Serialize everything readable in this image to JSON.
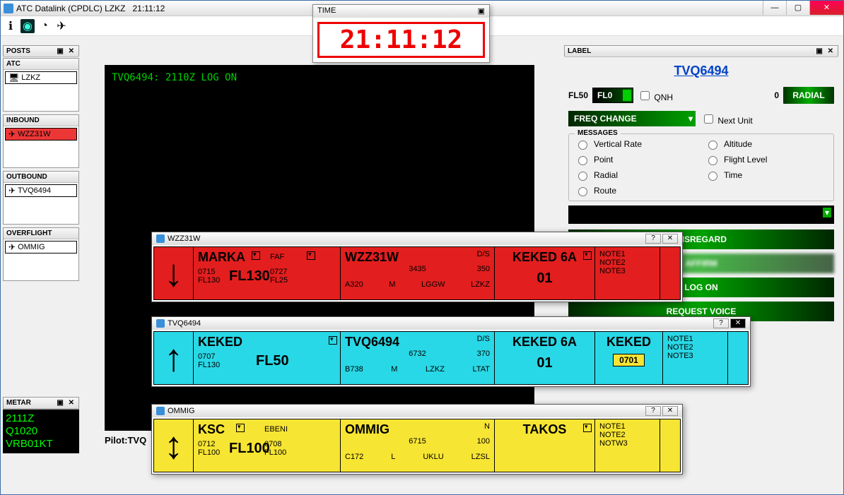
{
  "window": {
    "title": "ATC Datalink (CPDLC) LZKZ",
    "clock": "21:11:12"
  },
  "time_popup": {
    "title": "TIME",
    "value": "21:11:12"
  },
  "panels": {
    "posts_hdr": "POSTS",
    "atc": {
      "title": "ATC",
      "item": "LZKZ"
    },
    "inbound": {
      "title": "INBOUND",
      "item": "WZZ31W"
    },
    "outbound": {
      "title": "OUTBOUND",
      "item": "TVQ6494"
    },
    "overflight": {
      "title": "OVERFLIGHT",
      "item": "OMMIG"
    }
  },
  "radar": {
    "log": "TVQ6494: 2110Z LOG ON",
    "pilot": "Pilot:TVQ"
  },
  "metar": {
    "title": "METAR",
    "l1": "2111Z",
    "l2": "Q1020",
    "l3": "VRB01KT"
  },
  "label": {
    "title": "LABEL",
    "callsign": "TVQ6494",
    "fl_current": "FL50",
    "fl_dd": "FL0",
    "qnh_lbl": "QNH",
    "qnh_val": "0",
    "radial_btn": "RADIAL",
    "freq_dd": "FREQ CHANGE",
    "next_unit": "Next Unit",
    "msgs_title": "MESSAGES",
    "msgs": [
      "Vertical Rate",
      "Altitude",
      "Point",
      "Flight Level",
      "Radial",
      "Time",
      "Route"
    ],
    "buttons": {
      "disregard": "DISREGARD",
      "affirm": "AFFIRM",
      "logon": "LOG ON",
      "reqv": "REQUEST VOICE"
    }
  },
  "strips": {
    "wzz": {
      "title": "WZZ31W",
      "arrow": "↓",
      "wpt": "MARKA",
      "t1": "0715",
      "fl1": "FL130",
      "cfl": "FL130",
      "faf": "FAF",
      "t2": "0727",
      "fl2": "FL25",
      "cs": "WZZ31W",
      "sq": "3435",
      "ds": "D/S",
      "wt": "350",
      "type": "A320",
      "cat": "M",
      "dep": "LGGW",
      "arr": "LZKZ",
      "sid": "KEKED 6A",
      "rwy": "01",
      "n1": "NOTE1",
      "n2": "NOTE2",
      "n3": "NOTE3"
    },
    "tvq": {
      "title": "TVQ6494",
      "arrow": "↑",
      "wpt": "KEKED",
      "t1": "0707",
      "fl1": "FL130",
      "cfl": "FL50",
      "cs": "TVQ6494",
      "sq": "6732",
      "ds": "D/S",
      "wt": "370",
      "type": "B738",
      "cat": "M",
      "dep": "LZKZ",
      "arr": "LTAT",
      "sid": "KEKED 6A",
      "rwy": "01",
      "hold": "KEKED",
      "holdtime": "0701",
      "n1": "NOTE1",
      "n2": "NOTE2",
      "n3": "NOTE3"
    },
    "omm": {
      "title": "OMMIG",
      "arrow": "↕",
      "wpt": "KSC",
      "t1": "0712",
      "fl1": "FL100",
      "cfl": "FL100",
      "faf": "EBENI",
      "t2": "0708",
      "fl2": "FL100",
      "cs": "OMMIG",
      "sq": "6715",
      "ds": "N",
      "wt": "100",
      "type": "C172",
      "cat": "L",
      "dep": "UKLU",
      "arr": "LZSL",
      "sid": "TAKOS",
      "n1": "NOTE1",
      "n2": "NOTE2",
      "n3": "NOTW3"
    }
  }
}
